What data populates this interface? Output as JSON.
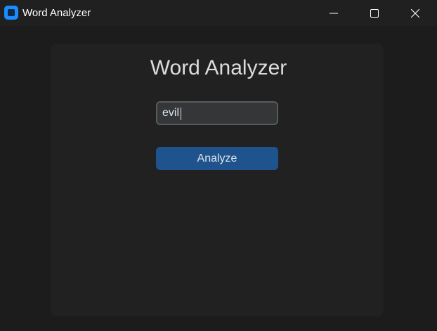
{
  "window": {
    "title": "Word Analyzer",
    "controls": {
      "minimize_icon": "minimize-icon",
      "maximize_icon": "maximize-icon",
      "close_icon": "close-icon"
    }
  },
  "main": {
    "heading": "Word Analyzer",
    "word_input": {
      "value": "evil",
      "placeholder": ""
    },
    "analyze_button_label": "Analyze"
  },
  "colors": {
    "window_bg": "#1c1c1c",
    "titlebar_bg": "#202020",
    "panel_bg": "#212121",
    "input_bg": "#343638",
    "input_border": "#565b5e",
    "button_bg": "#1f538d",
    "text": "#dce4ee",
    "app_icon": "#1a8cff"
  }
}
